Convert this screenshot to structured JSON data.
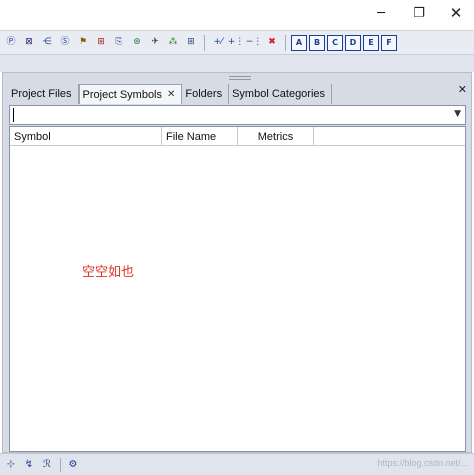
{
  "window": {
    "minimize_glyph": "─",
    "maximize_glyph": "❐",
    "close_glyph": "✕"
  },
  "toolbar": {
    "group1": [
      {
        "icon": "project-icon",
        "glyph": "Ⓟ",
        "color": "#1b3f95"
      },
      {
        "icon": "window-layout-icon",
        "glyph": "⊠",
        "color": "#2a2a7a"
      },
      {
        "icon": "tree-icon",
        "glyph": "⋲",
        "color": "#2a4a8a"
      },
      {
        "icon": "symbol-list-icon",
        "glyph": "Ⓢ",
        "color": "#1b3f95"
      },
      {
        "icon": "flowchart-icon",
        "glyph": "⚑",
        "color": "#8a5a10"
      },
      {
        "icon": "relation-icon",
        "glyph": "⊞",
        "color": "#a02020"
      },
      {
        "icon": "document-icon",
        "glyph": "⎘",
        "color": "#30508a"
      },
      {
        "icon": "search-web-icon",
        "glyph": "⊛",
        "color": "#208040"
      },
      {
        "icon": "bird-icon",
        "glyph": "✈",
        "color": "#3a3a3a"
      },
      {
        "icon": "network-icon",
        "glyph": "⁂",
        "color": "#3a8020"
      },
      {
        "icon": "grid-icon",
        "glyph": "⊞",
        "color": "#2a4a8a"
      }
    ],
    "group2": [
      {
        "icon": "add-minus-icon",
        "glyph": "+⁄",
        "color": "#1b3f95"
      },
      {
        "icon": "add-list-icon",
        "glyph": "+⋮",
        "color": "#1b3f95"
      },
      {
        "icon": "remove-list-icon",
        "glyph": "−⋮",
        "color": "#1b3f95"
      },
      {
        "icon": "delete-icon",
        "glyph": "✖",
        "color": "#d02020"
      }
    ],
    "group3": [
      {
        "icon": "box-a-icon",
        "glyph": "A"
      },
      {
        "icon": "box-b-icon",
        "glyph": "B"
      },
      {
        "icon": "box-c-icon",
        "glyph": "C"
      },
      {
        "icon": "box-d-icon",
        "glyph": "D"
      },
      {
        "icon": "box-e-icon",
        "glyph": "E"
      },
      {
        "icon": "box-f-icon",
        "glyph": "F"
      }
    ]
  },
  "panel": {
    "grip_label": "",
    "tabs": [
      {
        "label": "Project Files",
        "active": false
      },
      {
        "label": "Project Symbols",
        "active": true,
        "close": "✕"
      },
      {
        "label": "Folders",
        "active": false
      },
      {
        "label": "Symbol Categories",
        "active": false
      }
    ],
    "close_glyph": "✕",
    "combo": {
      "value": "",
      "arrow": "▼"
    },
    "columns": [
      "Symbol",
      "File Name",
      "Metrics"
    ],
    "rows": [],
    "empty_note": "空空如也"
  },
  "bottom_bar": {
    "icons": [
      {
        "icon": "symbol-add-icon",
        "glyph": "⊹",
        "color": "#1b3f95"
      },
      {
        "icon": "new-item-icon",
        "glyph": "↯",
        "color": "#1b3f95"
      },
      {
        "icon": "italic-r-icon",
        "glyph": "ℛ",
        "color": "#1b3f95"
      },
      {
        "icon": "gear-icon",
        "glyph": "⚙",
        "color": "#1b3f95"
      }
    ],
    "watermark": "https://blog.csdn.net/..."
  }
}
